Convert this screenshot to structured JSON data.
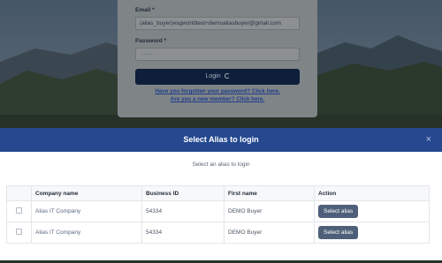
{
  "login": {
    "email_label": "Email *",
    "email_value": "(alias_buyer)esgworldtest+demoaliasbuyer@gmail.com",
    "password_label": "Password *",
    "password_value": "·······",
    "login_button": "Login",
    "forgot_link": "Have you forgotten your password? Click here.",
    "new_member_link": "Are you a new member? Click here."
  },
  "modal": {
    "title": "Select Alias to login",
    "close": "×",
    "subtitle": "Select an alias to login",
    "columns": [
      "Company name",
      "Business ID",
      "First name",
      "Action"
    ],
    "rows": [
      {
        "company": "Alias IT Company",
        "business_id": "54334",
        "first_name": "DEMO Buyer",
        "action": "Select alias"
      },
      {
        "company": "Alias IT Company",
        "business_id": "54334",
        "first_name": "DEMO Buyer",
        "action": "Select alias"
      }
    ]
  }
}
